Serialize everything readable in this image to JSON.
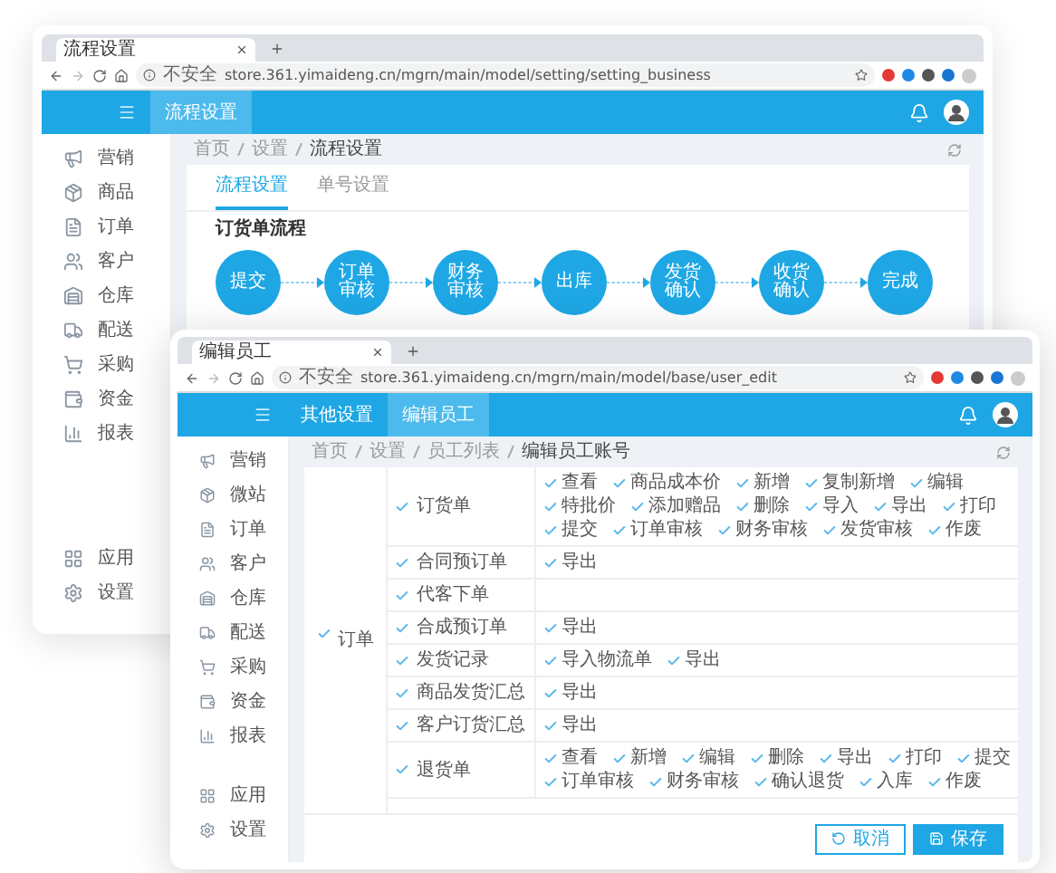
{
  "back_window": {
    "tab_title": "流程设置",
    "security": "不安全",
    "url": "store.361.yimaideng.cn/mgrn/main/model/setting/setting_business",
    "nav": [
      {
        "label": "流程设置",
        "selected": true
      }
    ],
    "sidebar": {
      "items": [
        {
          "label": "营销"
        },
        {
          "label": "商品"
        },
        {
          "label": "订单"
        },
        {
          "label": "客户"
        },
        {
          "label": "仓库"
        },
        {
          "label": "配送"
        },
        {
          "label": "采购"
        },
        {
          "label": "资金"
        },
        {
          "label": "报表"
        }
      ],
      "bottom_items": [
        {
          "label": "应用"
        },
        {
          "label": "设置"
        }
      ]
    },
    "breadcrumb": [
      "首页",
      "设置",
      "流程设置"
    ],
    "tabs": [
      {
        "label": "流程设置",
        "selected": true
      },
      {
        "label": "单号设置",
        "selected": false
      }
    ],
    "section_title": "订货单流程",
    "steps": [
      "提交",
      "订单审核",
      "财务审核",
      "出库",
      "发货确认",
      "收货确认",
      "完成"
    ]
  },
  "front_window": {
    "tab_title": "编辑员工",
    "security": "不安全",
    "url": "store.361.yimaideng.cn/mgrn/main/model/base/user_edit",
    "nav": [
      {
        "label": "其他设置",
        "selected": false
      },
      {
        "label": "编辑员工",
        "selected": true
      }
    ],
    "sidebar": {
      "items": [
        {
          "label": "营销"
        },
        {
          "label": "微站"
        },
        {
          "label": "订单"
        },
        {
          "label": "客户"
        },
        {
          "label": "仓库"
        },
        {
          "label": "配送"
        },
        {
          "label": "采购"
        },
        {
          "label": "资金"
        },
        {
          "label": "报表"
        }
      ],
      "bottom_items": [
        {
          "label": "应用"
        },
        {
          "label": "设置"
        }
      ]
    },
    "breadcrumb": [
      "首页",
      "设置",
      "员工列表",
      "编辑员工账号"
    ],
    "permission_group": {
      "label": "订单",
      "checked": true
    },
    "permissions": [
      {
        "label": "订货单",
        "checked": true,
        "actions": [
          {
            "label": "查看",
            "checked": true
          },
          {
            "label": "商品成本价",
            "checked": true
          },
          {
            "label": "新增",
            "checked": true
          },
          {
            "label": "复制新增",
            "checked": true
          },
          {
            "label": "编辑",
            "checked": true
          },
          {
            "label": "特批价",
            "checked": true
          },
          {
            "label": "添加赠品",
            "checked": true
          },
          {
            "label": "删除",
            "checked": true
          },
          {
            "label": "导入",
            "checked": true
          },
          {
            "label": "导出",
            "checked": true
          },
          {
            "label": "打印",
            "checked": true
          },
          {
            "label": "提交",
            "checked": true
          },
          {
            "label": "订单审核",
            "checked": true
          },
          {
            "label": "财务审核",
            "checked": true
          },
          {
            "label": "发货审核",
            "checked": true
          },
          {
            "label": "作废",
            "checked": true
          }
        ]
      },
      {
        "label": "合同预订单",
        "checked": true,
        "actions": [
          {
            "label": "导出",
            "checked": true
          }
        ]
      },
      {
        "label": "代客下单",
        "checked": true
      },
      {
        "label": "合成预订单",
        "checked": true,
        "actions": [
          {
            "label": "导出",
            "checked": true
          }
        ]
      },
      {
        "label": "发货记录",
        "checked": true,
        "actions": [
          {
            "label": "导入物流单",
            "checked": true
          },
          {
            "label": "导出",
            "checked": true
          }
        ]
      },
      {
        "label": "商品发货汇总",
        "checked": true,
        "actions": [
          {
            "label": "导出",
            "checked": true
          }
        ]
      },
      {
        "label": "客户订货汇总",
        "checked": true,
        "actions": [
          {
            "label": "导出",
            "checked": true
          }
        ]
      },
      {
        "label": "退货单",
        "checked": true,
        "actions": [
          {
            "label": "查看",
            "checked": true
          },
          {
            "label": "新增",
            "checked": true
          },
          {
            "label": "编辑",
            "checked": true
          },
          {
            "label": "删除",
            "checked": true
          },
          {
            "label": "导出",
            "checked": true
          },
          {
            "label": "打印",
            "checked": true
          },
          {
            "label": "提交",
            "checked": true
          },
          {
            "label": "订单审核",
            "checked": true
          },
          {
            "label": "财务审核",
            "checked": true
          },
          {
            "label": "确认退货",
            "checked": true
          },
          {
            "label": "入库",
            "checked": true
          },
          {
            "label": "作废",
            "checked": true
          }
        ]
      }
    ],
    "buttons": [
      {
        "label": "取消",
        "kind": "secondary"
      },
      {
        "label": "保存",
        "kind": "primary"
      }
    ]
  }
}
